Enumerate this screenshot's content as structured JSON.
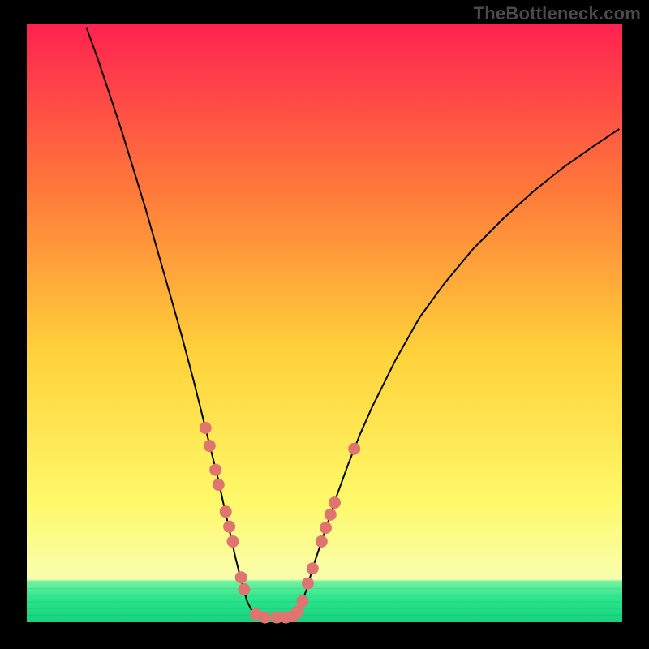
{
  "watermark": "TheBottleneck.com",
  "colors": {
    "frame": "#000000",
    "curve": "#000000",
    "marker_fill": "#e0746e",
    "marker_stroke": "#d35e57",
    "grad_top": "#ff2250",
    "grad_mid_upper": "#ff7a3a",
    "grad_mid": "#ffd23a",
    "grad_mid_lower": "#fff96a",
    "grad_band": "#f8ffae",
    "grad_green1": "#6ff2a2",
    "grad_green2": "#2de58b",
    "grad_green3": "#15d27e"
  },
  "chart_data": {
    "type": "line",
    "title": "",
    "xlabel": "",
    "ylabel": "",
    "xlim": [
      0,
      100
    ],
    "ylim": [
      0,
      100
    ],
    "curve": [
      {
        "x": 10.0,
        "y": 99.5
      },
      {
        "x": 12.0,
        "y": 94.0
      },
      {
        "x": 14.0,
        "y": 88.0
      },
      {
        "x": 16.0,
        "y": 82.0
      },
      {
        "x": 18.0,
        "y": 75.5
      },
      {
        "x": 20.0,
        "y": 69.0
      },
      {
        "x": 22.0,
        "y": 62.0
      },
      {
        "x": 24.0,
        "y": 55.0
      },
      {
        "x": 26.0,
        "y": 48.0
      },
      {
        "x": 28.0,
        "y": 40.5
      },
      {
        "x": 29.0,
        "y": 36.5
      },
      {
        "x": 30.0,
        "y": 32.5
      },
      {
        "x": 31.0,
        "y": 28.5
      },
      {
        "x": 32.0,
        "y": 24.5
      },
      {
        "x": 33.0,
        "y": 20.0
      },
      {
        "x": 34.0,
        "y": 15.5
      },
      {
        "x": 35.0,
        "y": 11.0
      },
      {
        "x": 36.0,
        "y": 7.0
      },
      {
        "x": 37.0,
        "y": 3.5
      },
      {
        "x": 38.0,
        "y": 1.5
      },
      {
        "x": 40.0,
        "y": 0.7
      },
      {
        "x": 42.0,
        "y": 0.7
      },
      {
        "x": 44.0,
        "y": 0.8
      },
      {
        "x": 45.0,
        "y": 1.2
      },
      {
        "x": 46.0,
        "y": 2.8
      },
      {
        "x": 47.0,
        "y": 5.5
      },
      {
        "x": 48.0,
        "y": 9.0
      },
      {
        "x": 50.0,
        "y": 15.0
      },
      {
        "x": 52.0,
        "y": 21.0
      },
      {
        "x": 54.0,
        "y": 26.5
      },
      {
        "x": 56.0,
        "y": 31.5
      },
      {
        "x": 58.0,
        "y": 36.0
      },
      {
        "x": 62.0,
        "y": 44.0
      },
      {
        "x": 66.0,
        "y": 51.0
      },
      {
        "x": 70.0,
        "y": 56.5
      },
      {
        "x": 75.0,
        "y": 62.5
      },
      {
        "x": 80.0,
        "y": 67.5
      },
      {
        "x": 85.0,
        "y": 72.0
      },
      {
        "x": 90.0,
        "y": 76.0
      },
      {
        "x": 95.0,
        "y": 79.5
      },
      {
        "x": 99.5,
        "y": 82.5
      }
    ],
    "markers": [
      {
        "x": 30.0,
        "y": 32.5
      },
      {
        "x": 30.7,
        "y": 29.5
      },
      {
        "x": 31.7,
        "y": 25.5
      },
      {
        "x": 32.2,
        "y": 23.0
      },
      {
        "x": 33.4,
        "y": 18.5
      },
      {
        "x": 34.0,
        "y": 16.0
      },
      {
        "x": 34.6,
        "y": 13.5
      },
      {
        "x": 36.0,
        "y": 7.5
      },
      {
        "x": 36.5,
        "y": 5.5
      },
      {
        "x": 38.5,
        "y": 1.3
      },
      {
        "x": 40.0,
        "y": 0.8
      },
      {
        "x": 42.0,
        "y": 0.8
      },
      {
        "x": 43.5,
        "y": 0.8
      },
      {
        "x": 44.7,
        "y": 1.0
      },
      {
        "x": 45.5,
        "y": 1.8
      },
      {
        "x": 46.3,
        "y": 3.5
      },
      {
        "x": 47.2,
        "y": 6.5
      },
      {
        "x": 48.0,
        "y": 9.0
      },
      {
        "x": 49.5,
        "y": 13.5
      },
      {
        "x": 50.2,
        "y": 15.8
      },
      {
        "x": 51.0,
        "y": 18.0
      },
      {
        "x": 51.7,
        "y": 20.0
      },
      {
        "x": 55.0,
        "y": 29.0
      }
    ],
    "bottom_band": {
      "y_start": 7.2,
      "y_end": 0,
      "sub_lines": [
        5.6,
        4.5,
        3.4,
        2.3,
        1.2
      ]
    }
  }
}
